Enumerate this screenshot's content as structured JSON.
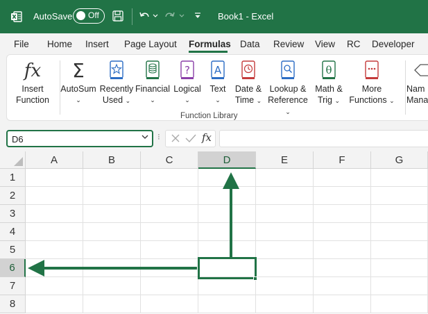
{
  "titlebar": {
    "autosave_label": "AutoSave",
    "autosave_state": "Off",
    "doc_title": "Book1  -  Excel"
  },
  "tabs": [
    "File",
    "Home",
    "Insert",
    "Page Layout",
    "Formulas",
    "Data",
    "Review",
    "View",
    "RC",
    "Developer"
  ],
  "active_tab": "Formulas",
  "ribbon": {
    "insert_function": {
      "line1": "Insert",
      "line2": "Function"
    },
    "autosum": {
      "label": "AutoSum"
    },
    "recently_used": {
      "line1": "Recently",
      "line2": "Used"
    },
    "financial": {
      "label": "Financial"
    },
    "logical": {
      "label": "Logical"
    },
    "text": {
      "label": "Text"
    },
    "date_time": {
      "line1": "Date &",
      "line2": "Time"
    },
    "lookup": {
      "line1": "Lookup &",
      "line2": "Reference"
    },
    "math": {
      "line1": "Math &",
      "line2": "Trig"
    },
    "more": {
      "line1": "More",
      "line2": "Functions"
    },
    "name_manager": {
      "line1": "Nam",
      "line2": "Mana"
    },
    "group_label": "Function Library"
  },
  "formula_bar": {
    "name_box": "D6",
    "insert_fx": "fx",
    "formula": ""
  },
  "grid": {
    "columns": [
      "A",
      "B",
      "C",
      "D",
      "E",
      "F",
      "G"
    ],
    "rows": [
      "1",
      "2",
      "3",
      "4",
      "5",
      "6",
      "7",
      "8"
    ],
    "selected_column": "D",
    "selected_row": "6",
    "accent_color": "#217346"
  }
}
